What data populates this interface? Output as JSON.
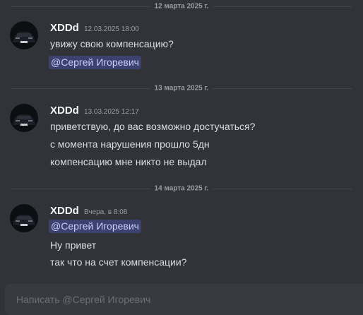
{
  "messages": [
    {
      "date_divider": "12 марта 2025 г.",
      "author": "XDDd",
      "timestamp": "12.03.2025 18:00",
      "lines": [
        "увижу свою компенсацию?"
      ],
      "mention": "@Сергей Игоревич"
    },
    {
      "date_divider": "13 марта 2025 г.",
      "author": "XDDd",
      "timestamp": "13.03.2025 12:17",
      "lines": [
        "приветствую, до вас возможно достучаться?",
        "с момента нарушения прошло 5дн",
        "компенсацию мне никто не выдал"
      ]
    },
    {
      "date_divider": "14 марта 2025 г.",
      "author": "XDDd",
      "timestamp": "Вчера, в 8:08",
      "mention": "@Сергей Игоревич",
      "lines": [
        "Ну привет",
        "так что на счет компенсации?"
      ]
    }
  ],
  "composer": {
    "placeholder": "Написать @Сергей Игоревич"
  },
  "colors": {
    "background": "#323339",
    "mention_bg": "#3c4270",
    "mention_text": "#c9cdfb",
    "muted_text": "#9a9ca3"
  }
}
